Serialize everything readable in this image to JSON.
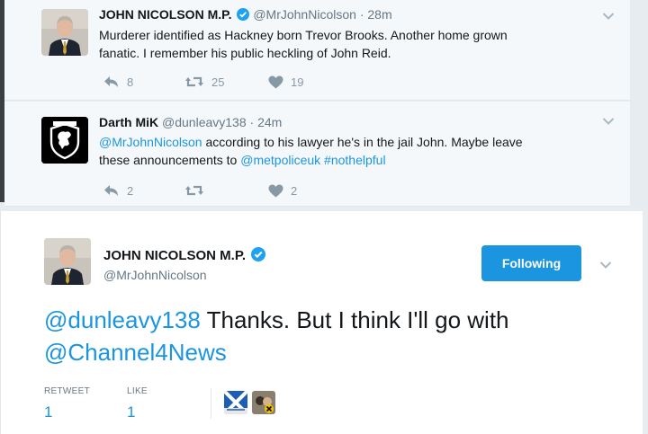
{
  "colors": {
    "link": "#1b95e0",
    "muted": "#8899a6",
    "background": "#e6ecf0",
    "verified": "#1da1f2"
  },
  "replies": [
    {
      "name": "JOHN NICOLSON M.P.",
      "verified": true,
      "handle": "@MrJohnNicolson",
      "dot": "·",
      "time": "28m",
      "text_line1": "Murderer identified as Hackney born Trevor Brooks. Another home grown",
      "text_line2": "fanatic. I remember his public heckling of John Reid.",
      "reply_count": "8",
      "retweet_count": "25",
      "like_count": "19",
      "avatar_icon": "portrait-photo"
    },
    {
      "name": "Darth MiK",
      "verified": false,
      "handle": "@dunleavy138",
      "dot": "·",
      "time": "24m",
      "mention1": "@MrJohnNicolson",
      "text_mid1": " according to his lawyer he's in the jail John. Maybe leave",
      "text_mid2": "these announcements to ",
      "mention2": "@metpoliceuk",
      "hashtag": "#nothelpful",
      "reply_count": "2",
      "retweet_count": "",
      "like_count": "2",
      "avatar_icon": "lion-crest-badge"
    }
  ],
  "main_tweet": {
    "name": "JOHN NICOLSON M.P.",
    "verified": true,
    "handle": "@MrJohnNicolson",
    "follow_label": "Following",
    "mention1": "@dunleavy138",
    "text_mid": " Thanks. But I think I'll go with",
    "mention2": "@Channel4News",
    "retweet_label": "RETWEET",
    "retweet_value": "1",
    "like_label": "LIKE",
    "like_value": "1",
    "likers": [
      "saltire-flag-avatar",
      "portrait-avatar"
    ]
  }
}
